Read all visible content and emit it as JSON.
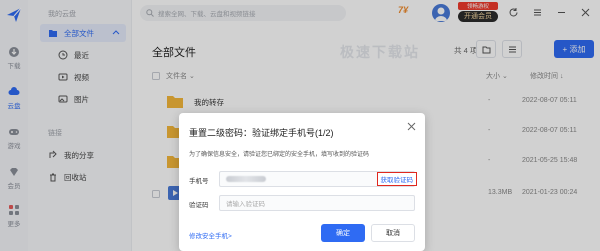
{
  "rail": {
    "items": [
      {
        "label": "下载",
        "icon": "download-icon"
      },
      {
        "label": "云盘",
        "icon": "cloud-icon"
      },
      {
        "label": "游戏",
        "icon": "gamepad-icon"
      },
      {
        "label": "会员",
        "icon": "diamond-icon"
      },
      {
        "label": "更多",
        "icon": "grid-icon"
      }
    ]
  },
  "sidebar": {
    "section_mine": "我的云盘",
    "all_files": "全部文件",
    "recent": "最近",
    "video": "视频",
    "image": "图片",
    "section_share": "链接",
    "my_share": "我的分享",
    "recycle": "回收站"
  },
  "topbar": {
    "search_placeholder": "搜索全网、下载、云盘和视频链接",
    "points": "7¥",
    "vip_tag": "领畅游权",
    "vip_button": "开通会员"
  },
  "content": {
    "title": "全部文件",
    "count": "共 4 项",
    "add_label": "+ 添加",
    "watermark": "极速下载站",
    "columns": {
      "name": "文件名",
      "size": "大小",
      "modified": "修改时间"
    },
    "rows": [
      {
        "name": "我的转存",
        "size": "-",
        "date": "2022-08-07 05:11",
        "type": "folder"
      },
      {
        "name": "",
        "size": "-",
        "date": "2022-08-07 05:11",
        "type": "folder"
      },
      {
        "name": "",
        "size": "-",
        "date": "2021-05-25 15:48",
        "type": "folder"
      },
      {
        "name": "",
        "size": "13.3MB",
        "date": "2021-01-23 00:24",
        "type": "video"
      }
    ]
  },
  "modal": {
    "title": "重置二级密码：验证绑定手机号(1/2)",
    "description": "为了确保信息安全，请验证您已绑定的安全手机，填写收到的验证码",
    "phone_label": "手机号",
    "code_label": "验证码",
    "code_placeholder": "请输入验证码",
    "get_code": "获取验证码",
    "change_phone": "修改安全手机>",
    "confirm": "确定",
    "cancel": "取消"
  },
  "colors": {
    "accent": "#2f6bf3",
    "highlight": "#e0281f",
    "folder": "#f5b73b"
  }
}
